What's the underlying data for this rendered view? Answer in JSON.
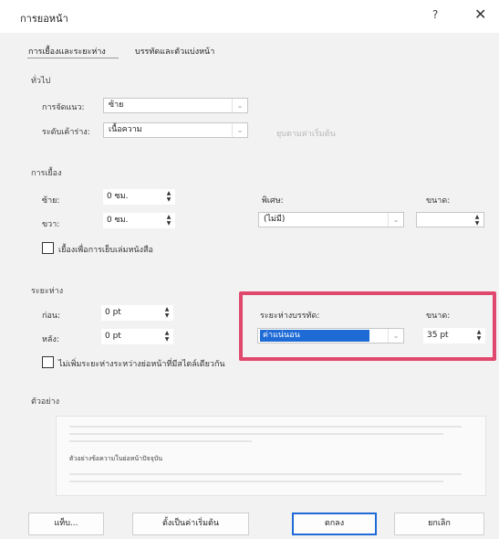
{
  "dialog": {
    "title": "การยอหน้า",
    "help_label": "?",
    "close_label": "✕"
  },
  "tabs": [
    {
      "label": "การเยื้องและระยะห่าง",
      "active": true
    },
    {
      "label": "บรรทัดและตัวแบ่งหน้า",
      "active": false
    }
  ],
  "general": {
    "section_label": "ทั่วไป",
    "alignment_label": "การจัดแนว:",
    "alignment_value": "ซ้าย",
    "outline_level_label": "ระดับเค้าร่าง:",
    "outline_level_value": "เนื้อความ",
    "collapsed_default_label": "ยุบตามค่าเริ่มต้น"
  },
  "indentation": {
    "section_label": "การเยื้อง",
    "left_label": "ซ้าย:",
    "left_value": "0 ซม.",
    "right_label": "ขวา:",
    "right_value": "0 ซม.",
    "special_label": "พิเศษ:",
    "special_value": "(ไม่มี)",
    "by_label": "ขนาด:",
    "by_value": "",
    "mirror_label": "เยื้องเพื่อการเย็บเล่มหนังสือ"
  },
  "spacing": {
    "section_label": "ระยะห่าง",
    "before_label": "ก่อน:",
    "before_value": "0 pt",
    "after_label": "หลัง:",
    "after_value": "0 pt",
    "line_spacing_label": "ระยะห่างบรรทัด:",
    "line_spacing_value": "ค่าแน่นอน",
    "at_label": "ขนาด:",
    "at_value": "35 pt",
    "dont_add_label": "ไม่เพิ่มระยะห่างระหว่างย่อหน้าที่มีสไตล์เดียวกัน"
  },
  "preview": {
    "section_label": "ตัวอย่าง",
    "sample_text": "ตัวอย่างข้อความในย่อหน้าปัจจุบัน"
  },
  "buttons": {
    "tabs_label": "แท็บ...",
    "default_label": "ตั้งเป็นค่าเริ่มต้น",
    "ok_label": "ตกลง",
    "cancel_label": "ยกเลิก"
  },
  "colors": {
    "highlight_border": "#e1486d",
    "selection_blue": "#1e6bd6"
  }
}
